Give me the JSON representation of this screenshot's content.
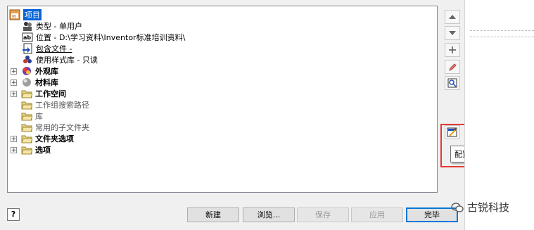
{
  "tree": {
    "root": {
      "label": "项目"
    },
    "children": [
      {
        "text": "类型 - 单用户",
        "icon": "user-type-icon"
      },
      {
        "text": "位置 - D:\\学习资料\\Inventor标准培训资料\\",
        "icon": "ab-text-icon"
      },
      {
        "text": "包含文件 -",
        "icon": "include-file-icon"
      },
      {
        "text": "使用样式库 - 只读",
        "icon": "style-library-icon"
      }
    ],
    "groups": [
      {
        "label": "外观库",
        "icon": "appearance-library-icon",
        "expandable": true,
        "bold": true
      },
      {
        "label": "材料库",
        "icon": "material-library-icon",
        "expandable": true,
        "bold": true
      },
      {
        "label": "工作空间",
        "icon": "folder-icon",
        "expandable": true,
        "bold": true
      },
      {
        "label": "工作组搜索路径",
        "icon": "folder-icon",
        "expandable": false,
        "bold": false
      },
      {
        "label": "库",
        "icon": "folder-icon",
        "expandable": false,
        "bold": false
      },
      {
        "label": "常用的子文件夹",
        "icon": "folder-icon",
        "expandable": false,
        "bold": false
      },
      {
        "label": "文件夹选项",
        "icon": "folder-icon",
        "expandable": true,
        "bold": true
      },
      {
        "label": "选项",
        "icon": "folder-icon",
        "expandable": true,
        "bold": true
      }
    ]
  },
  "side_tools": [
    "move-up-icon",
    "move-down-icon",
    "add-icon",
    "edit-icon",
    "find-icon",
    "configure-content-center-icon"
  ],
  "tooltip": "配置资源中心库",
  "buttons": {
    "help": "?",
    "new": "新建",
    "browse": "浏览...",
    "save": "保存",
    "apply": "应用",
    "done": "完毕"
  },
  "watermark": "古锐科技",
  "colors": {
    "selection": "#0a64d6",
    "highlight_box": "#e53935",
    "primary_border": "#0078d7"
  }
}
